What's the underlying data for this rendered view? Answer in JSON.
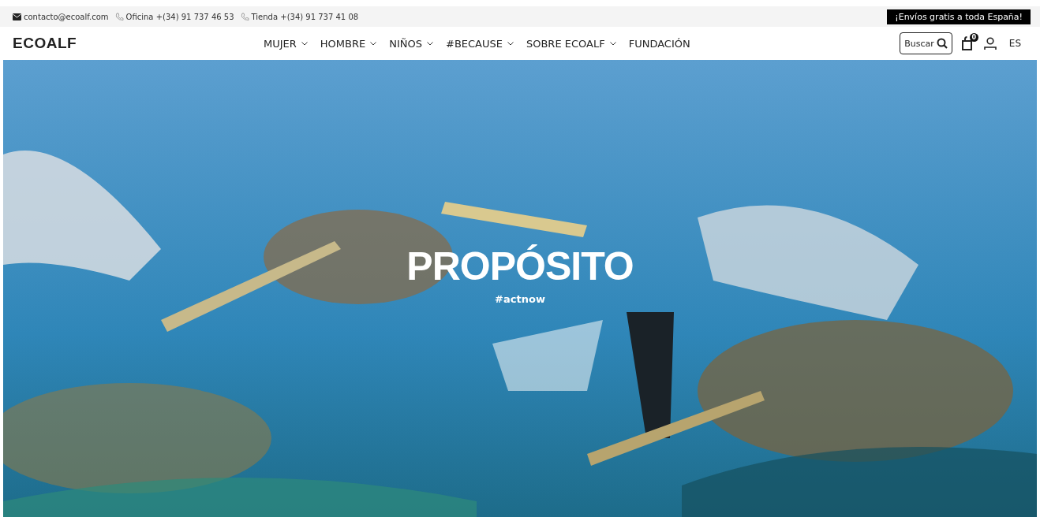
{
  "top_bar": {
    "email": "contacto@ecoalf.com",
    "phones": [
      {
        "text": "Oficina +(34) 91 737 46 53"
      },
      {
        "text": "Tienda +(34) 91 737 41 08"
      }
    ],
    "promo": "¡Envíos gratis a toda España!"
  },
  "header": {
    "logo": "ECOALF",
    "nav": [
      {
        "label": "MUJER",
        "has_dropdown": true
      },
      {
        "label": "HOMBRE",
        "has_dropdown": true
      },
      {
        "label": "NIÑOS",
        "has_dropdown": true
      },
      {
        "label": "#BECAUSE",
        "has_dropdown": true
      },
      {
        "label": "SOBRE ECOALF",
        "has_dropdown": true
      },
      {
        "label": "FUNDACIÓN",
        "has_dropdown": false
      }
    ],
    "search": {
      "label": "Buscar"
    },
    "cart_count": "0",
    "language": "ES"
  },
  "hero": {
    "kind": "picture",
    "title": "PROPÓSITO",
    "subtitle": "#actnow"
  }
}
